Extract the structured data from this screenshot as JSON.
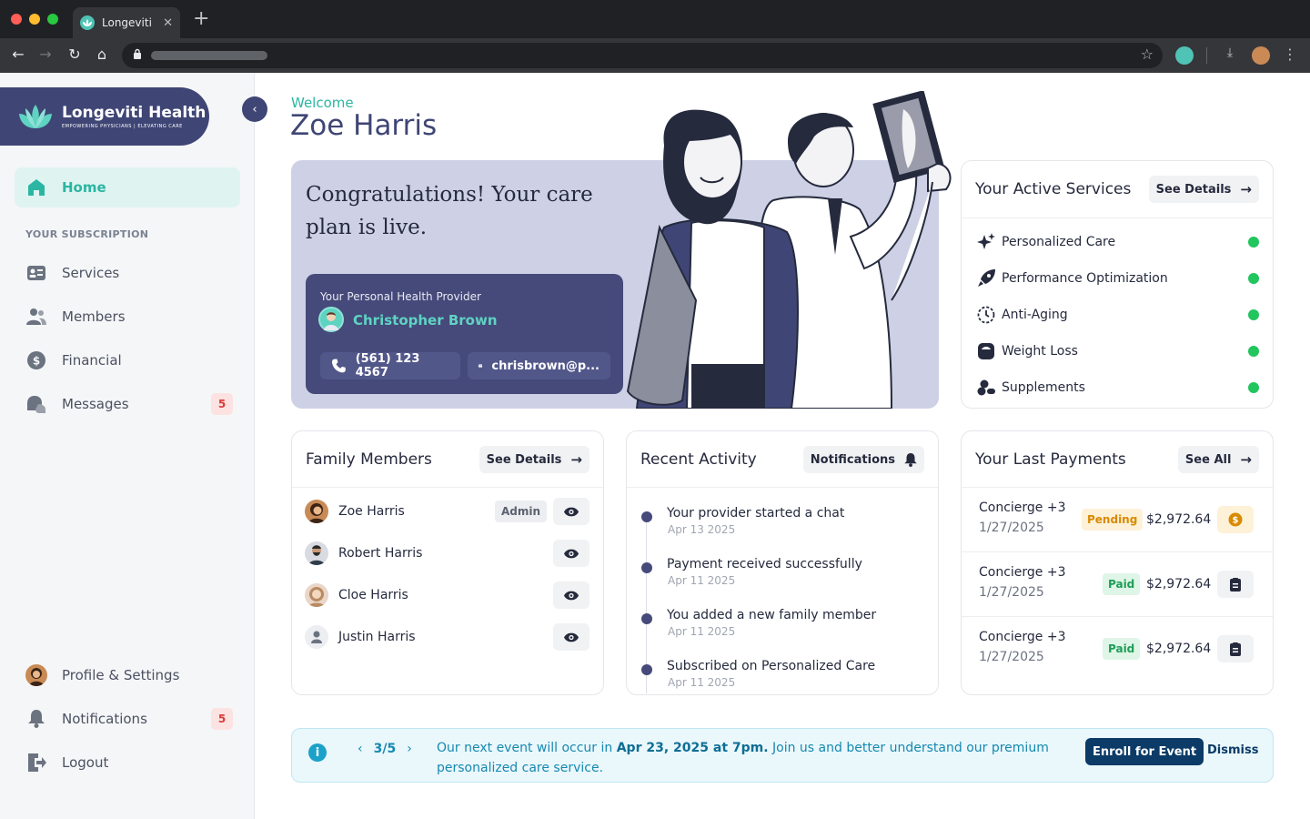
{
  "browser": {
    "tab_title": "Longeviti",
    "tab_close": "✕",
    "new_tab": "+"
  },
  "brand": {
    "name": "Longeviti Health",
    "tagline": "EMPOWERING PHYSICIANS | ELEVATING CARE"
  },
  "sidebar": {
    "home_label": "Home",
    "subscription_header": "YOUR SUBSCRIPTION",
    "items": [
      {
        "label": "Services",
        "icon": "id-card-icon"
      },
      {
        "label": "Members",
        "icon": "users-icon"
      },
      {
        "label": "Financial",
        "icon": "dollar-icon"
      },
      {
        "label": "Messages",
        "icon": "messages-icon",
        "badge": "5"
      }
    ],
    "bottom": [
      {
        "label": "Profile & Settings",
        "icon": "avatar"
      },
      {
        "label": "Notifications",
        "icon": "bell-icon",
        "badge": "5"
      },
      {
        "label": "Logout",
        "icon": "logout-icon"
      }
    ]
  },
  "welcome": {
    "greeting": "Welcome",
    "name": "Zoe Harris"
  },
  "hero": {
    "title": "Congratulations! Your care plan is live.",
    "provider_label": "Your Personal Health Provider",
    "provider_name": "Christopher Brown",
    "phone": "(561) 123 4567",
    "email": "chrisbrown@p..."
  },
  "services": {
    "title": "Your Active Services",
    "button": "See Details",
    "items": [
      {
        "label": "Personalized Care",
        "icon": "sparkle-icon",
        "status": "active"
      },
      {
        "label": "Performance Optimization",
        "icon": "rocket-icon",
        "status": "active"
      },
      {
        "label": "Anti-Aging",
        "icon": "clock-icon",
        "status": "active"
      },
      {
        "label": "Weight Loss",
        "icon": "scale-icon",
        "status": "active"
      },
      {
        "label": "Supplements",
        "icon": "pills-icon",
        "status": "active"
      }
    ]
  },
  "family": {
    "title": "Family Members",
    "button": "See Details",
    "members": [
      {
        "name": "Zoe Harris",
        "role": "Admin"
      },
      {
        "name": "Robert Harris",
        "role": ""
      },
      {
        "name": "Cloe Harris",
        "role": ""
      },
      {
        "name": "Justin Harris",
        "role": ""
      }
    ]
  },
  "activity": {
    "title": "Recent Activity",
    "button": "Notifications",
    "items": [
      {
        "text": "Your provider started a chat",
        "date": "Apr 13 2025"
      },
      {
        "text": "Payment received successfully",
        "date": "Apr 11 2025"
      },
      {
        "text": "You added a new family member",
        "date": "Apr 11 2025"
      },
      {
        "text": "Subscribed on Personalized Care",
        "date": "Apr 11 2025"
      }
    ]
  },
  "payments": {
    "title": "Your Last Payments",
    "button": "See All",
    "items": [
      {
        "title": "Concierge +3",
        "date": "1/27/2025",
        "status": "Pending",
        "amount": "$2,972.64"
      },
      {
        "title": "Concierge +3",
        "date": "1/27/2025",
        "status": "Paid",
        "amount": "$2,972.64"
      },
      {
        "title": "Concierge +3",
        "date": "1/27/2025",
        "status": "Paid",
        "amount": "$2,972.64"
      }
    ]
  },
  "banner": {
    "pager": "3/5",
    "msg_pre": "Our next event will occur in ",
    "msg_bold": "Apr 23, 2025 at 7pm.",
    "msg_post": " Join us and better understand our premium personalized care service.",
    "enroll": "Enroll for Event",
    "dismiss": "Dismiss"
  },
  "colors": {
    "brand": "#3f4675",
    "accent": "#2bb6a3",
    "active_dot": "#22c55e",
    "pending": "#d98a00",
    "paid": "#1f9d57"
  }
}
